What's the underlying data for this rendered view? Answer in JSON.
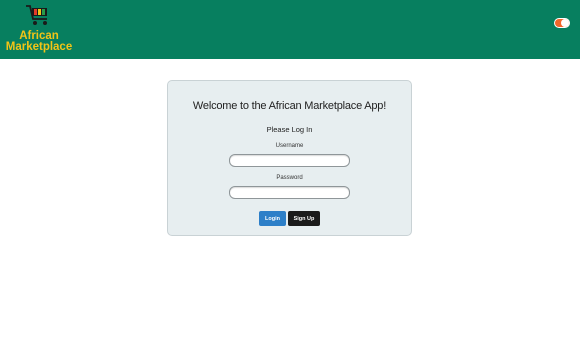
{
  "header": {
    "logo_text_line1": "African",
    "logo_text_line2": "Marketplace",
    "toggle": {
      "state": "on",
      "color": "#f2662a"
    },
    "bg_color": "#077f5f",
    "logo_color": "#f2c417"
  },
  "login": {
    "welcome": "Welcome to the African Marketplace App!",
    "subtitle": "Please Log In",
    "username_label": "Username",
    "username_value": "",
    "password_label": "Password",
    "password_value": "",
    "login_button": "Login",
    "signup_button": "Sign Up"
  },
  "icons": {
    "logo": "shopping-cart-icon",
    "toggle": "toggle-switch"
  }
}
